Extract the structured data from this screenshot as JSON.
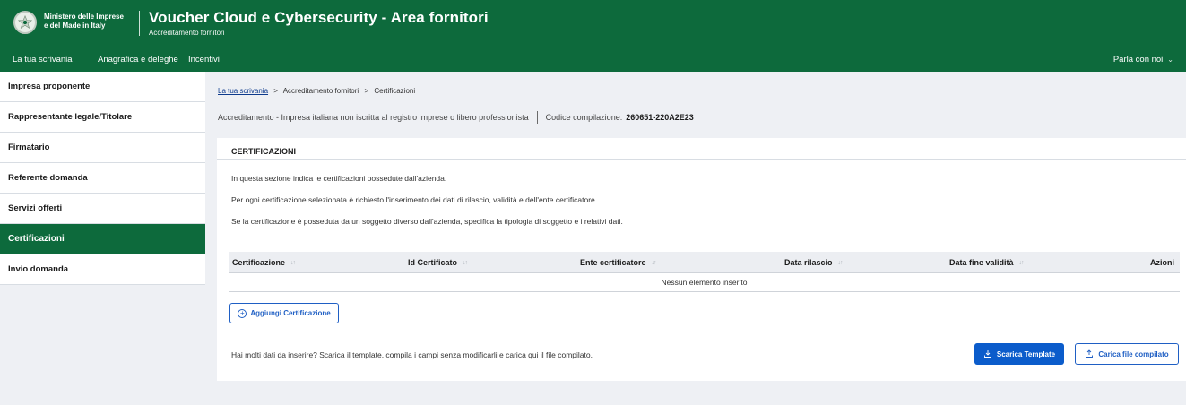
{
  "header": {
    "ministry_line1": "Ministero delle Imprese",
    "ministry_line2": "e del Made in Italy",
    "title": "Voucher Cloud e Cybersecurity - Area fornitori",
    "subtitle": "Accreditamento fornitori",
    "emblem_icon": "emblem-icon"
  },
  "nav": {
    "items": [
      "La tua scrivania",
      "Anagrafica e deleghe",
      "Incentivi"
    ],
    "right_label": "Parla con noi",
    "right_icon": "chevron-down-icon"
  },
  "sidebar": {
    "items": [
      {
        "label": "Impresa proponente",
        "active": false
      },
      {
        "label": "Rappresentante legale/Titolare",
        "active": false
      },
      {
        "label": "Firmatario",
        "active": false
      },
      {
        "label": "Referente domanda",
        "active": false
      },
      {
        "label": "Servizi offerti",
        "active": false
      },
      {
        "label": "Certificazioni",
        "active": true
      },
      {
        "label": "Invio domanda",
        "active": false
      }
    ]
  },
  "breadcrumb": {
    "home": "La tua scrivania",
    "separator": ">",
    "level2": "Accreditamento fornitori",
    "current": "Certificazioni"
  },
  "meta": {
    "description": "Accreditamento - Impresa italiana non iscritta al registro imprese o libero professionista",
    "code_label": "Codice compilazione:",
    "code_value": "260651-220A2E23"
  },
  "section": {
    "title": "CERTIFICAZIONI",
    "intro": [
      "In questa sezione indica le certificazioni possedute dall'azienda.",
      "Per ogni certificazione selezionata è richiesto l'inserimento dei dati di rilascio, validità e dell'ente certificatore.",
      "Se la certificazione è posseduta da un soggetto diverso dall'azienda, specifica la tipologia di soggetto e i relativi dati."
    ]
  },
  "table": {
    "columns": [
      "Certificazione",
      "Id Certificato",
      "Ente certificatore",
      "Data rilascio",
      "Data fine validità",
      "Azioni"
    ],
    "empty_message": "Nessun elemento inserito"
  },
  "actions": {
    "add_label": "Aggiungi Certificazione",
    "bulk_text": "Hai molti dati da inserire? Scarica il template, compila i campi senza modificarli e carica qui il file compilato.",
    "download_label": "Scarica Template",
    "upload_label": "Carica file compilato"
  },
  "colors": {
    "brand_green": "#0d6a3c",
    "primary_blue": "#0b5ccb",
    "background": "#eef0f4"
  }
}
